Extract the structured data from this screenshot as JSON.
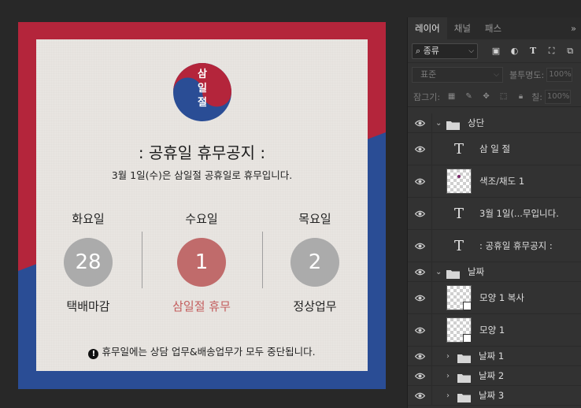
{
  "design": {
    "colors": {
      "red": "#b4253b",
      "blue": "#2a4d95",
      "paper": "#e8e5e1",
      "grey_circle": "#ababab",
      "holiday_circle": "#c06b6b",
      "holiday_text": "#c35d5d"
    },
    "emblem_text": [
      "삼",
      "일",
      "절"
    ],
    "title": ": 공휴일 휴무공지 :",
    "subtitle": "3월 1일(수)은 삼일절 공휴일로 휴무입니다.",
    "days": [
      {
        "name": "화요일",
        "date": "28",
        "status": "택배마감",
        "holiday": false
      },
      {
        "name": "수요일",
        "date": "1",
        "status": "삼일절 휴무",
        "holiday": true
      },
      {
        "name": "목요일",
        "date": "2",
        "status": "정상업무",
        "holiday": false
      }
    ],
    "notice_icon": "!",
    "notice": "휴무일에는 상담 업무&배송업무가 모두 중단됩니다."
  },
  "panel": {
    "tabs": [
      "레이어",
      "채널",
      "패스"
    ],
    "active_tab": "레이어",
    "collapse": "»",
    "filter_kind": "종류",
    "blend_mode": "표준",
    "opacity_label": "불투명도:",
    "opacity_value": "100%",
    "lock_label": "잠그기:",
    "fill_label": "칠:",
    "fill_value": "100%",
    "layers": [
      {
        "type": "group",
        "name": "상단",
        "expanded": true,
        "indent": 0
      },
      {
        "type": "text",
        "name": "삼 일 절",
        "indent": 1
      },
      {
        "type": "adjust",
        "name": "색조/채도 1",
        "indent": 1
      },
      {
        "type": "text",
        "name": "3월 1일(...무입니다.",
        "indent": 1
      },
      {
        "type": "text",
        "name": ": 공휴일 휴무공지 :",
        "indent": 1
      },
      {
        "type": "group",
        "name": "날짜",
        "expanded": true,
        "indent": 0
      },
      {
        "type": "shape",
        "name": "모양 1 복사",
        "indent": 1
      },
      {
        "type": "shape",
        "name": "모양 1",
        "indent": 1
      },
      {
        "type": "group",
        "name": "날짜 1",
        "expanded": false,
        "indent": 1
      },
      {
        "type": "group",
        "name": "날짜 2",
        "expanded": false,
        "indent": 1
      },
      {
        "type": "group",
        "name": "날짜 3",
        "expanded": false,
        "indent": 1
      }
    ]
  }
}
